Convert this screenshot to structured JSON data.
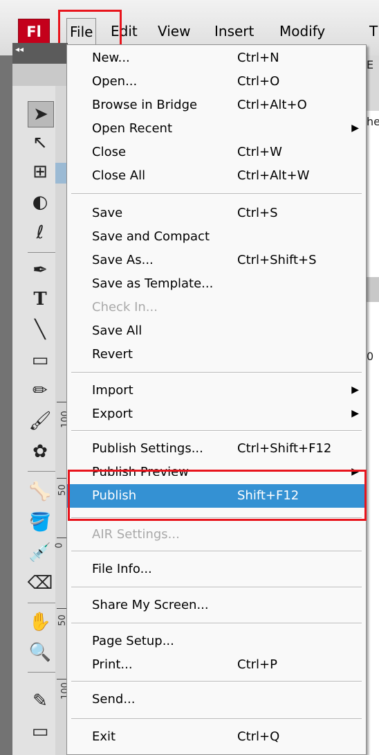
{
  "app": {
    "logo_text": "Fl",
    "logo_color": "#c4001b"
  },
  "menubar": {
    "items": [
      {
        "label": "File",
        "active": true
      },
      {
        "label": "Edit"
      },
      {
        "label": "View"
      },
      {
        "label": "Insert"
      },
      {
        "label": "Modify"
      },
      {
        "label": "T"
      }
    ]
  },
  "toolbox": {
    "collapse_icon_text": "◂◂",
    "tools": [
      {
        "name": "selection-tool-icon",
        "glyph": "➤",
        "selected": true
      },
      {
        "name": "subselection-tool-icon",
        "glyph": "↖"
      },
      {
        "name": "free-transform-tool-icon",
        "glyph": "⊞"
      },
      {
        "name": "3d-rotation-tool-icon",
        "glyph": "◐"
      },
      {
        "name": "lasso-tool-icon",
        "glyph": "ℓ"
      },
      {
        "name": "pen-tool-icon",
        "glyph": "✒"
      },
      {
        "name": "text-tool-icon",
        "glyph": "T"
      },
      {
        "name": "line-tool-icon",
        "glyph": "╲"
      },
      {
        "name": "rectangle-tool-icon",
        "glyph": "▭"
      },
      {
        "name": "pencil-tool-icon",
        "glyph": "✏"
      },
      {
        "name": "brush-tool-icon",
        "glyph": "🖌"
      },
      {
        "name": "deco-tool-icon",
        "glyph": "✿"
      },
      {
        "name": "bone-tool-icon",
        "glyph": "🦴"
      },
      {
        "name": "paint-bucket-tool-icon",
        "glyph": "🪣"
      },
      {
        "name": "eyedropper-tool-icon",
        "glyph": "💉"
      },
      {
        "name": "eraser-tool-icon",
        "glyph": "⌫"
      },
      {
        "name": "hand-tool-icon",
        "glyph": "✋"
      },
      {
        "name": "zoom-tool-icon",
        "glyph": "🔍"
      },
      {
        "name": "stroke-color-icon",
        "glyph": "✎"
      },
      {
        "name": "fill-color-icon",
        "glyph": "▭"
      }
    ]
  },
  "ruler": {
    "ticks": [
      "100",
      "50",
      "0",
      "50",
      "100"
    ]
  },
  "right_panel": {
    "texts": [
      "E",
      "he",
      "0"
    ]
  },
  "file_menu": {
    "items": [
      {
        "label": "New...",
        "shortcut": "Ctrl+N"
      },
      {
        "label": "Open...",
        "shortcut": "Ctrl+O"
      },
      {
        "label": "Browse in Bridge",
        "shortcut": "Ctrl+Alt+O"
      },
      {
        "label": "Open Recent",
        "shortcut": "",
        "submenu": true
      },
      {
        "label": "Close",
        "shortcut": "Ctrl+W"
      },
      {
        "label": "Close All",
        "shortcut": "Ctrl+Alt+W"
      },
      {
        "separator": true
      },
      {
        "label": "Save",
        "shortcut": "Ctrl+S"
      },
      {
        "label": "Save and Compact",
        "shortcut": ""
      },
      {
        "label": "Save As...",
        "shortcut": "Ctrl+Shift+S"
      },
      {
        "label": "Save as Template...",
        "shortcut": ""
      },
      {
        "label": "Check In...",
        "shortcut": "",
        "disabled": true
      },
      {
        "label": "Save All",
        "shortcut": ""
      },
      {
        "label": "Revert",
        "shortcut": ""
      },
      {
        "separator": true
      },
      {
        "label": "Import",
        "shortcut": "",
        "submenu": true
      },
      {
        "label": "Export",
        "shortcut": "",
        "submenu": true
      },
      {
        "separator": true
      },
      {
        "label": "Publish Settings...",
        "shortcut": "Ctrl+Shift+F12"
      },
      {
        "label": "Publish Preview",
        "shortcut": "",
        "submenu": true
      },
      {
        "label": "Publish",
        "shortcut": "Shift+F12",
        "highlighted": true
      },
      {
        "separator": true
      },
      {
        "label": "AIR Settings...",
        "shortcut": "",
        "disabled": true
      },
      {
        "separator": true
      },
      {
        "label": "File Info...",
        "shortcut": ""
      },
      {
        "separator": true
      },
      {
        "label": "Share My Screen...",
        "shortcut": ""
      },
      {
        "separator": true
      },
      {
        "label": "Page Setup...",
        "shortcut": ""
      },
      {
        "label": "Print...",
        "shortcut": "Ctrl+P"
      },
      {
        "separator": true
      },
      {
        "label": "Send...",
        "shortcut": ""
      },
      {
        "separator": true
      },
      {
        "label": "Exit",
        "shortcut": "Ctrl+Q"
      }
    ]
  },
  "colors": {
    "highlight": "#3491d3",
    "annotation_box": "#e8141c"
  }
}
